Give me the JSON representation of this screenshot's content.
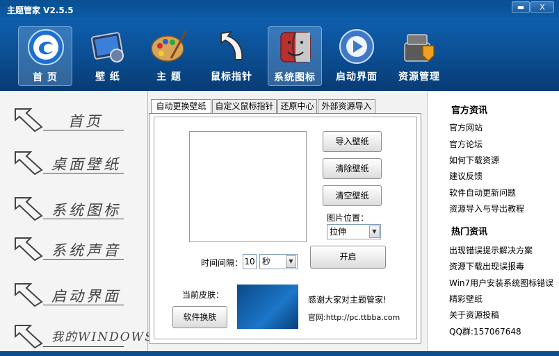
{
  "window": {
    "title": "主题管家 V2.5.5",
    "min_label": "▬",
    "close_label": "X"
  },
  "toolbar": [
    {
      "label": "首 页",
      "icon": "home-orb-icon"
    },
    {
      "label": "壁 纸",
      "icon": "wallpaper-icon"
    },
    {
      "label": "主 题",
      "icon": "palette-icon"
    },
    {
      "label": "鼠标指针",
      "icon": "cursor-arrow-icon"
    },
    {
      "label": "系统图标",
      "icon": "finder-icon"
    },
    {
      "label": "启动界面",
      "icon": "play-disc-icon"
    },
    {
      "label": "资源管理",
      "icon": "tools-icon"
    }
  ],
  "leftnav": [
    {
      "label": "首页"
    },
    {
      "label": "桌面壁纸"
    },
    {
      "label": "系统图标"
    },
    {
      "label": "系统声音"
    },
    {
      "label": "启动界面"
    },
    {
      "label": "我的WINDOWS"
    }
  ],
  "tabs": [
    "自动更换壁纸",
    "自定义鼠标指针",
    "还原中心",
    "外部资源导入"
  ],
  "panel": {
    "import_button": "导入壁纸",
    "remove_button": "清除壁纸",
    "clear_button": "清空壁纸",
    "position_label": "图片位置：",
    "position_value": "拉伸",
    "interval_label": "时间间隔：",
    "interval_value": "10",
    "interval_unit": "秒",
    "start_button": "开启",
    "current_skin_label": "当前皮肤：",
    "change_skin_button": "软件换肤",
    "thanks_text": "感谢大家对主题管家!",
    "site_text": "官网:http://pc.ttbba.com"
  },
  "right": {
    "official_heading": "官方资讯",
    "official_links": [
      "官方网站",
      "官方论坛",
      "如何下载资源",
      "建议反馈",
      "软件自动更新问题",
      "资源导入与导出教程"
    ],
    "hot_heading": "热门资讯",
    "hot_links": [
      "出现错误提示解决方案",
      "资源下载出现误报毒",
      "Win7用户安装系统图标错误",
      "精彩壁纸",
      "关于资源投稿",
      "QQ群:157067648"
    ]
  },
  "colors": {
    "titlebar": "#0b5ba6",
    "toolbar": "#0b4d91",
    "active_tool": "#5f8fc2"
  }
}
